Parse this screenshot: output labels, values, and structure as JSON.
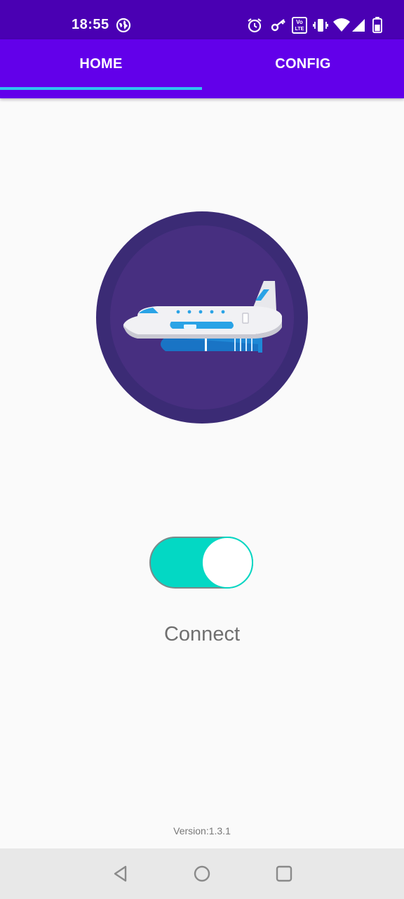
{
  "status_bar": {
    "time": "18:55",
    "icons": [
      "vpn-globe-icon",
      "alarm-icon",
      "key-icon",
      "volte-icon",
      "vibrate-icon",
      "wifi-icon",
      "signal-icon",
      "battery-icon"
    ],
    "volte_text": "Vo LTE",
    "background": "#4a00b3"
  },
  "tabs": [
    {
      "label": "HOME",
      "selected": true
    },
    {
      "label": "CONFIG",
      "selected": false
    }
  ],
  "tab_bar": {
    "background": "#6200ea",
    "indicator_color": "#2ec4f1"
  },
  "hero": {
    "icon": "airplane-logo"
  },
  "connect_switch": {
    "on": true,
    "label": "Connect",
    "color": "#03d8c4"
  },
  "version": "Version:1.3.1",
  "nav_bar": {
    "icons": [
      "back-icon",
      "home-icon",
      "recents-icon"
    ]
  }
}
